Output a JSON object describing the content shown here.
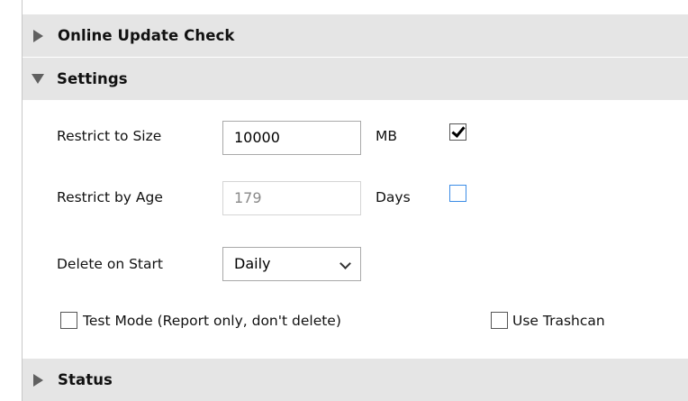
{
  "sections": {
    "update_title": "Online Update Check",
    "settings_title": "Settings",
    "status_title": "Status"
  },
  "settings": {
    "size": {
      "label": "Restrict to Size",
      "value": "10000",
      "unit": "MB",
      "enabled": true
    },
    "age": {
      "label": "Restrict by Age",
      "value": "179",
      "unit": "Days",
      "enabled": false
    },
    "delete_on_start": {
      "label": "Delete on Start",
      "selected": "Daily"
    },
    "test_mode": {
      "label": "Test Mode (Report only, don't delete)",
      "checked": false
    },
    "use_trashcan": {
      "label": "Use Trashcan",
      "checked": false
    }
  }
}
